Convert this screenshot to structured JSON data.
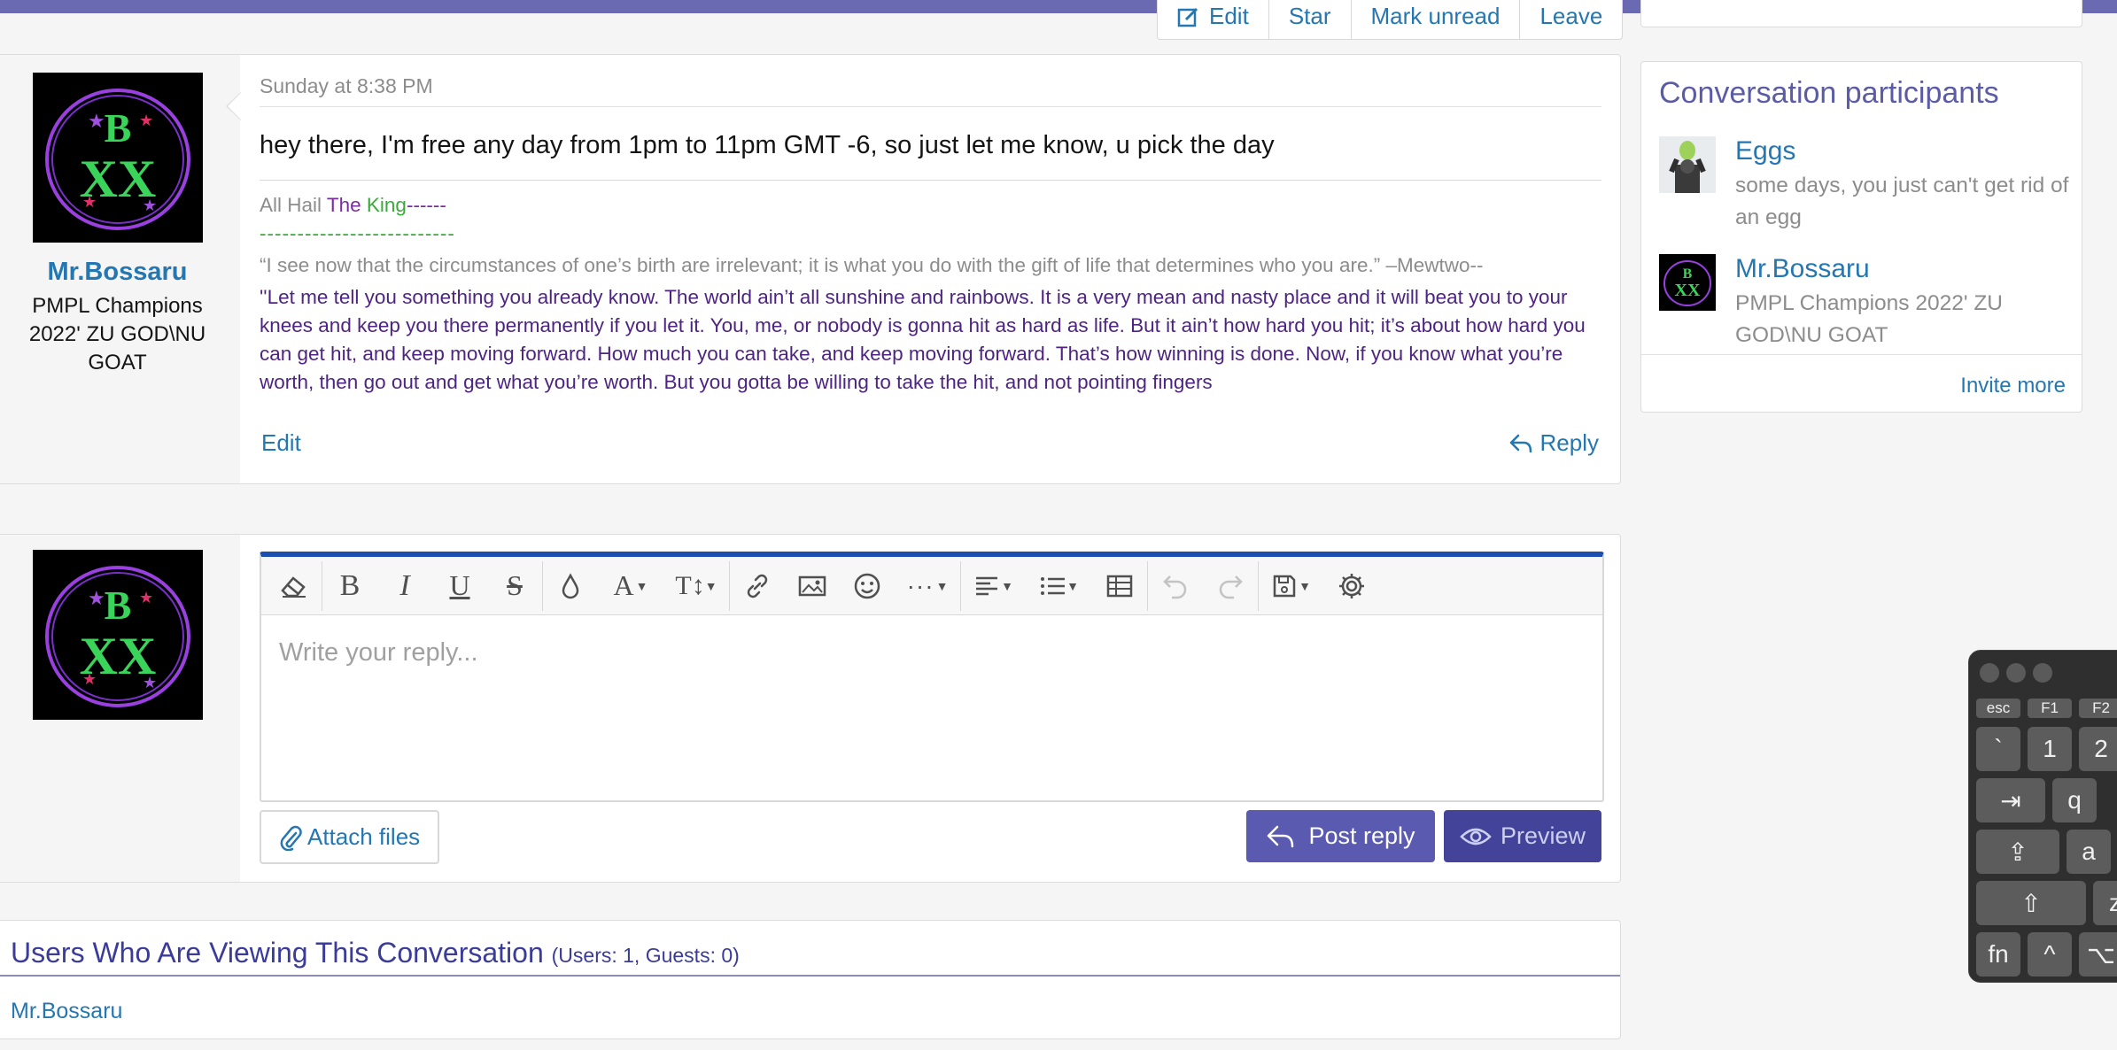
{
  "top_actions": {
    "edit": "Edit",
    "star": "Star",
    "mark_unread": "Mark unread",
    "leave": "Leave"
  },
  "message": {
    "author": "Mr.Bossaru",
    "author_title": "PMPL Champions 2022' ZU GOD\\NU GOAT",
    "date": "Sunday at 8:38 PM",
    "body": "hey there, I'm free any day from 1pm to 11pm GMT -6, so just let me know, u pick the day",
    "signature": {
      "line1_a": "All Hail ",
      "line1_the": "The ",
      "line1_king": "King",
      "line1_dashes": "------",
      "line2": "--------------------------",
      "quote1": "“I see now that the circumstances of one’s birth are irrelevant; it is what you do with the gift of life that determines who you are.” –Mewtwo--",
      "quote2": "''Let me tell you something you already know. The world ain’t all sunshine and rainbows. It is a very mean and nasty place and it will beat you to your knees and keep you there permanently if you let it. You, me, or nobody is gonna hit as hard as life. But it ain’t how hard you hit; it’s about how hard you can get hit, and keep moving forward. How much you can take, and keep moving forward. That’s how winning is done. Now, if you know what you’re worth, then go out and get what you’re worth. But you gotta be willing to take the hit, and not pointing fingers"
    },
    "edit_label": "Edit",
    "reply_label": "Reply"
  },
  "reply": {
    "placeholder": "Write your reply...",
    "attach_label": "Attach files",
    "post_label": "Post reply",
    "preview_label": "Preview",
    "toolbar_icons": [
      "eraser-icon",
      "bold-icon",
      "italic-icon",
      "underline-icon",
      "strikethrough-icon",
      "color-icon",
      "font-family-icon",
      "font-size-icon",
      "link-icon",
      "image-icon",
      "smilie-icon",
      "more-icon",
      "align-icon",
      "list-icon",
      "table-icon",
      "undo-icon",
      "redo-icon",
      "drafts-icon",
      "settings-icon"
    ]
  },
  "viewing": {
    "title": "Users Who Are Viewing This Conversation",
    "counts": "(Users: 1, Guests: 0)",
    "users": [
      "Mr.Bossaru"
    ]
  },
  "participants": {
    "title": "Conversation participants",
    "list": [
      {
        "name": "Eggs",
        "title": "some days, you just can't get rid of an egg"
      },
      {
        "name": "Mr.Bossaru",
        "title": "PMPL Champions 2022' ZU GOD\\NU GOAT"
      }
    ],
    "invite_label": "Invite more"
  },
  "keyboard": {
    "keys": [
      "esc",
      "F1",
      "F2",
      "`",
      "1",
      "2",
      "⇥",
      "q",
      "⇪",
      "a",
      "⇧",
      "z",
      "fn",
      "^",
      "⌥"
    ]
  },
  "colors": {
    "accent": "#2577b1",
    "brand": "#5b5ba6",
    "post_button": "#5a5ab0",
    "preview_button": "#43439a",
    "editor_top": "#1b4fb0"
  }
}
